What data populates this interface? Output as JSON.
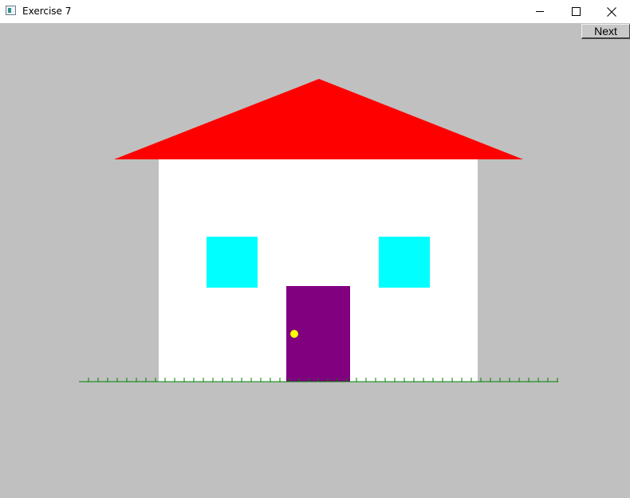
{
  "window": {
    "title": "Exercise 7",
    "controls": {
      "minimize": "minimize-icon",
      "maximize": "maximize-icon",
      "close": "close-icon"
    }
  },
  "toolbar": {
    "next_label": "Next"
  },
  "scene": {
    "background": "#c0c0c0",
    "roof_color": "#ff0000",
    "wall_color": "#ffffff",
    "window_color": "#00ffff",
    "door_color": "#800080",
    "knob_color": "#ffff00",
    "grass_color": "#008000"
  }
}
